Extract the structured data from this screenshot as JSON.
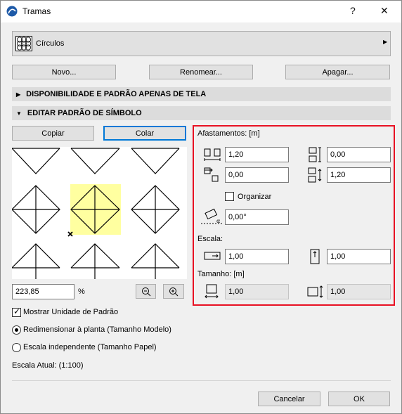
{
  "window": {
    "title": "Tramas",
    "help_label": "?",
    "close_label": "✕"
  },
  "selector": {
    "value": "Círculos",
    "icon": "pattern-grid-icon"
  },
  "actions": {
    "new_label": "Novo...",
    "rename_label": "Renomear...",
    "delete_label": "Apagar..."
  },
  "sections": {
    "availability": "DISPONIBILIDADE E PADRÃO APENAS DE TELA",
    "edit_symbol": "EDITAR PADRÃO DE SÍMBOLO"
  },
  "clipboard": {
    "copy_label": "Copiar",
    "paste_label": "Colar"
  },
  "zoom": {
    "value": "223,85",
    "unit": "%"
  },
  "spacing": {
    "title": "Afastamentos: [m]",
    "h_offset": "1,20",
    "v_offset": "0,00",
    "h_shift": "0,00",
    "v_spacing": "1,20",
    "arrange_label": "Organizar",
    "angle": "0,00°"
  },
  "scale": {
    "title": "Escala:",
    "x": "1,00",
    "y": "1,00"
  },
  "size": {
    "title": "Tamanho: [m]",
    "width": "1,00",
    "height": "1,00"
  },
  "options": {
    "show_unit_label": "Mostrar Unidade de Padrão",
    "resize_label": "Redimensionar à planta (Tamanho Modelo)",
    "independent_label": "Escala independente (Tamanho Papel)",
    "current_scale": "Escala Atual: (1:100)"
  },
  "footer": {
    "cancel_label": "Cancelar",
    "ok_label": "OK"
  },
  "colors": {
    "highlight_border": "#e81123",
    "pattern_cell": "#ffffa0",
    "accent": "#0078d7"
  }
}
